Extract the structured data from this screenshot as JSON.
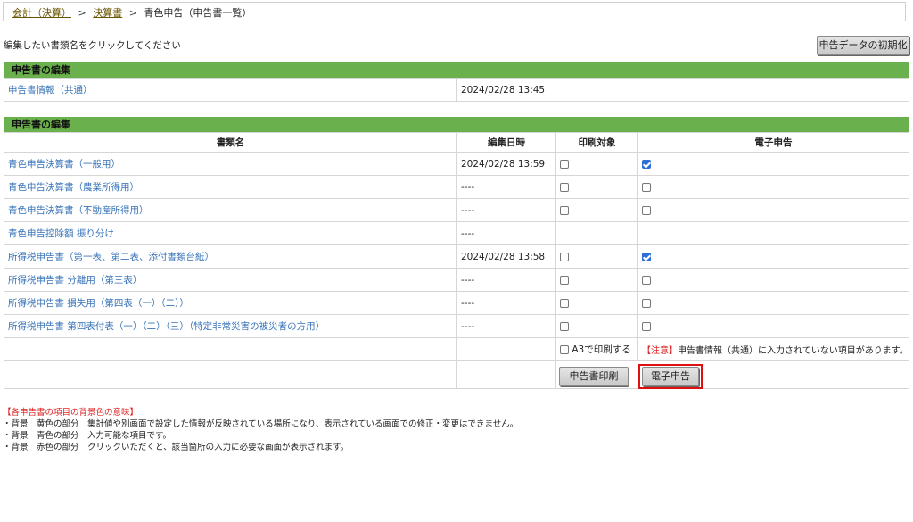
{
  "breadcrumb": {
    "items": [
      "会計（決算）",
      "決算書"
    ],
    "sep": ">",
    "current": "青色申告（申告書一覧）"
  },
  "instruction": "編集したい書類名をクリックしてください",
  "reset_button": "申告データの初期化",
  "section1": {
    "title": "申告書の編集",
    "row": {
      "name": "申告書情報（共通）",
      "date": "2024/02/28 13:45"
    }
  },
  "section2": {
    "title": "申告書の編集",
    "columns": [
      "書類名",
      "編集日時",
      "印刷対象",
      "電子申告"
    ],
    "rows": [
      {
        "name": "青色申告決算書（一般用）",
        "date": "2024/02/28 13:59",
        "print": false,
        "efile": true
      },
      {
        "name": "青色申告決算書（農業所得用）",
        "date": "----",
        "print": false,
        "efile": false
      },
      {
        "name": "青色申告決算書（不動産所得用）",
        "date": "----",
        "print": false,
        "efile": false
      },
      {
        "name": "青色申告控除額 振り分け",
        "date": "----",
        "print": null,
        "efile": null
      },
      {
        "name": "所得税申告書（第一表、第二表、添付書類台紙）",
        "date": "2024/02/28 13:58",
        "print": false,
        "efile": true
      },
      {
        "name": "所得税申告書 分離用（第三表）",
        "date": "----",
        "print": false,
        "efile": false
      },
      {
        "name": "所得税申告書 損失用（第四表（一）（二））",
        "date": "----",
        "print": false,
        "efile": false
      },
      {
        "name": "所得税申告書 第四表付表（一）（二）（三）（特定非常災害の被災者の方用）",
        "date": "----",
        "print": false,
        "efile": false
      }
    ],
    "a3_label": "A3で印刷する",
    "warning_tag": "【注意】",
    "warning_text": "申告書情報（共通）に入力されていない項目があります。",
    "print_button": "申告書印刷",
    "efile_button": "電子申告"
  },
  "legend": {
    "title": "【各申告書の項目の背景色の意味】",
    "lines": [
      "・背景　黄色の部分　集計値や別画面で設定した情報が反映されている場所になり、表示されている画面での修正・変更はできません。",
      "・背景　青色の部分　入力可能な項目です。",
      "・背景　赤色の部分　クリックいただくと、該当箇所の入力に必要な画面が表示されます。"
    ]
  }
}
